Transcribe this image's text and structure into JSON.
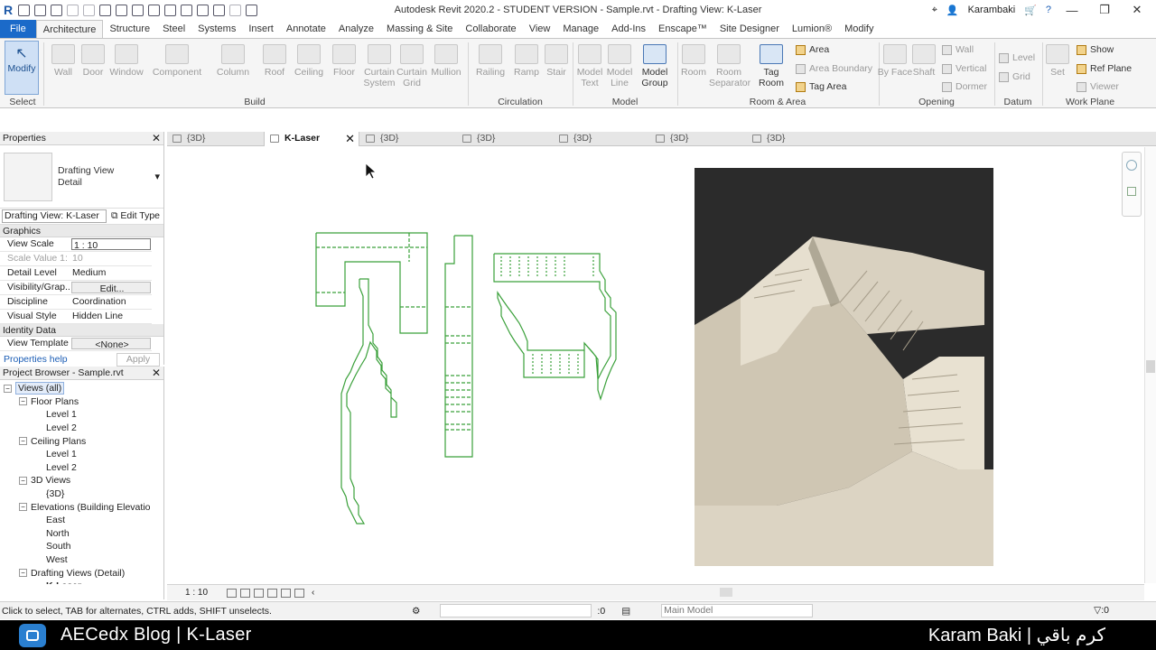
{
  "app": {
    "title": "Autodesk Revit 2020.2 - STUDENT VERSION - Sample.rvt - Drafting View: K-Laser",
    "user": "Karambaki"
  },
  "ribbon_tabs": [
    "File",
    "Architecture",
    "Structure",
    "Steel",
    "Systems",
    "Insert",
    "Annotate",
    "Analyze",
    "Massing & Site",
    "Collaborate",
    "View",
    "Manage",
    "Add-Ins",
    "Enscape™",
    "Site Designer",
    "Lumion®",
    "Modify"
  ],
  "ribbon": {
    "select": {
      "modify": "Modify",
      "panel": "Select"
    },
    "build": {
      "panel": "Build",
      "wall": "Wall",
      "door": "Door",
      "window": "Window",
      "component": "Component",
      "column": "Column",
      "roof": "Roof",
      "ceiling": "Ceiling",
      "floor": "Floor",
      "curtain_system": "Curtain System",
      "curtain_grid": "Curtain Grid",
      "mullion": "Mullion"
    },
    "circulation": {
      "panel": "Circulation",
      "railing": "Railing",
      "ramp": "Ramp",
      "stair": "Stair"
    },
    "model": {
      "panel": "Model",
      "model_text": "Model Text",
      "model_line": "Model Line",
      "model_group": "Model Group"
    },
    "room_area": {
      "panel": "Room & Area",
      "room": "Room",
      "room_separator": "Room Separator",
      "tag_room": "Tag Room",
      "area": "Area",
      "area_boundary": "Area Boundary",
      "tag_area": "Tag Area"
    },
    "opening": {
      "panel": "Opening",
      "by_face": "By Face",
      "shaft": "Shaft",
      "wall": "Wall",
      "vertical": "Vertical",
      "dormer": "Dormer"
    },
    "datum": {
      "panel": "Datum",
      "level": "Level",
      "grid": "Grid"
    },
    "work_plane": {
      "panel": "Work Plane",
      "set": "Set",
      "show": "Show",
      "ref_plane": "Ref Plane",
      "viewer": "Viewer"
    }
  },
  "properties": {
    "title": "Properties",
    "type_name": [
      "Drafting View",
      "Detail"
    ],
    "instance": "Drafting View: K-Laser",
    "edit_type": "Edit Type",
    "graphics_group": "Graphics",
    "graphics": [
      {
        "k": "View Scale",
        "v": "1 : 10"
      },
      {
        "k": "Scale Value   1:",
        "v": "10"
      },
      {
        "k": "Detail Level",
        "v": "Medium"
      },
      {
        "k": "Visibility/Grap...",
        "v": "Edit..."
      },
      {
        "k": "Discipline",
        "v": "Coordination"
      },
      {
        "k": "Visual Style",
        "v": "Hidden Line"
      }
    ],
    "identity_group": "Identity Data",
    "identity": [
      {
        "k": "View Template",
        "v": "<None>"
      }
    ],
    "help": "Properties help",
    "apply": "Apply"
  },
  "browser": {
    "title": "Project Browser - Sample.rvt",
    "items": [
      {
        "label": "Views (all)",
        "indent": 0,
        "exp": "−",
        "selected": true
      },
      {
        "label": "Floor Plans",
        "indent": 1,
        "exp": "−"
      },
      {
        "label": "Level 1",
        "indent": 2,
        "exp": ""
      },
      {
        "label": "Level 2",
        "indent": 2,
        "exp": ""
      },
      {
        "label": "Ceiling Plans",
        "indent": 1,
        "exp": "−"
      },
      {
        "label": "Level 1",
        "indent": 2,
        "exp": ""
      },
      {
        "label": "Level 2",
        "indent": 2,
        "exp": ""
      },
      {
        "label": "3D Views",
        "indent": 1,
        "exp": "−"
      },
      {
        "label": "{3D}",
        "indent": 2,
        "exp": ""
      },
      {
        "label": "Elevations (Building Elevatio",
        "indent": 1,
        "exp": "−"
      },
      {
        "label": "East",
        "indent": 2,
        "exp": ""
      },
      {
        "label": "North",
        "indent": 2,
        "exp": ""
      },
      {
        "label": "South",
        "indent": 2,
        "exp": ""
      },
      {
        "label": "West",
        "indent": 2,
        "exp": ""
      },
      {
        "label": "Drafting Views (Detail)",
        "indent": 1,
        "exp": "−"
      },
      {
        "label": "K-Laser",
        "indent": 2,
        "exp": ""
      }
    ]
  },
  "doc_tabs": [
    {
      "label": "{3D}",
      "active": false
    },
    {
      "label": "K-Laser",
      "active": true
    },
    {
      "label": "{3D}",
      "active": false
    },
    {
      "label": "{3D}",
      "active": false
    },
    {
      "label": "{3D}",
      "active": false
    },
    {
      "label": "{3D}",
      "active": false
    },
    {
      "label": "{3D}",
      "active": false
    }
  ],
  "view_control": {
    "scale": "1 : 10"
  },
  "status": {
    "message": "Click to select, TAB for alternates, CTRL adds, SHIFT unselects.",
    "count": ":0",
    "model": "Main Model",
    "filter": ":0"
  },
  "banner": {
    "title": "AECedx Blog | K-Laser",
    "author": "Karam Baki | كرم باقي"
  },
  "colors": {
    "accent": "#1b6ac9",
    "drafting_lines": "#3aa03a"
  }
}
